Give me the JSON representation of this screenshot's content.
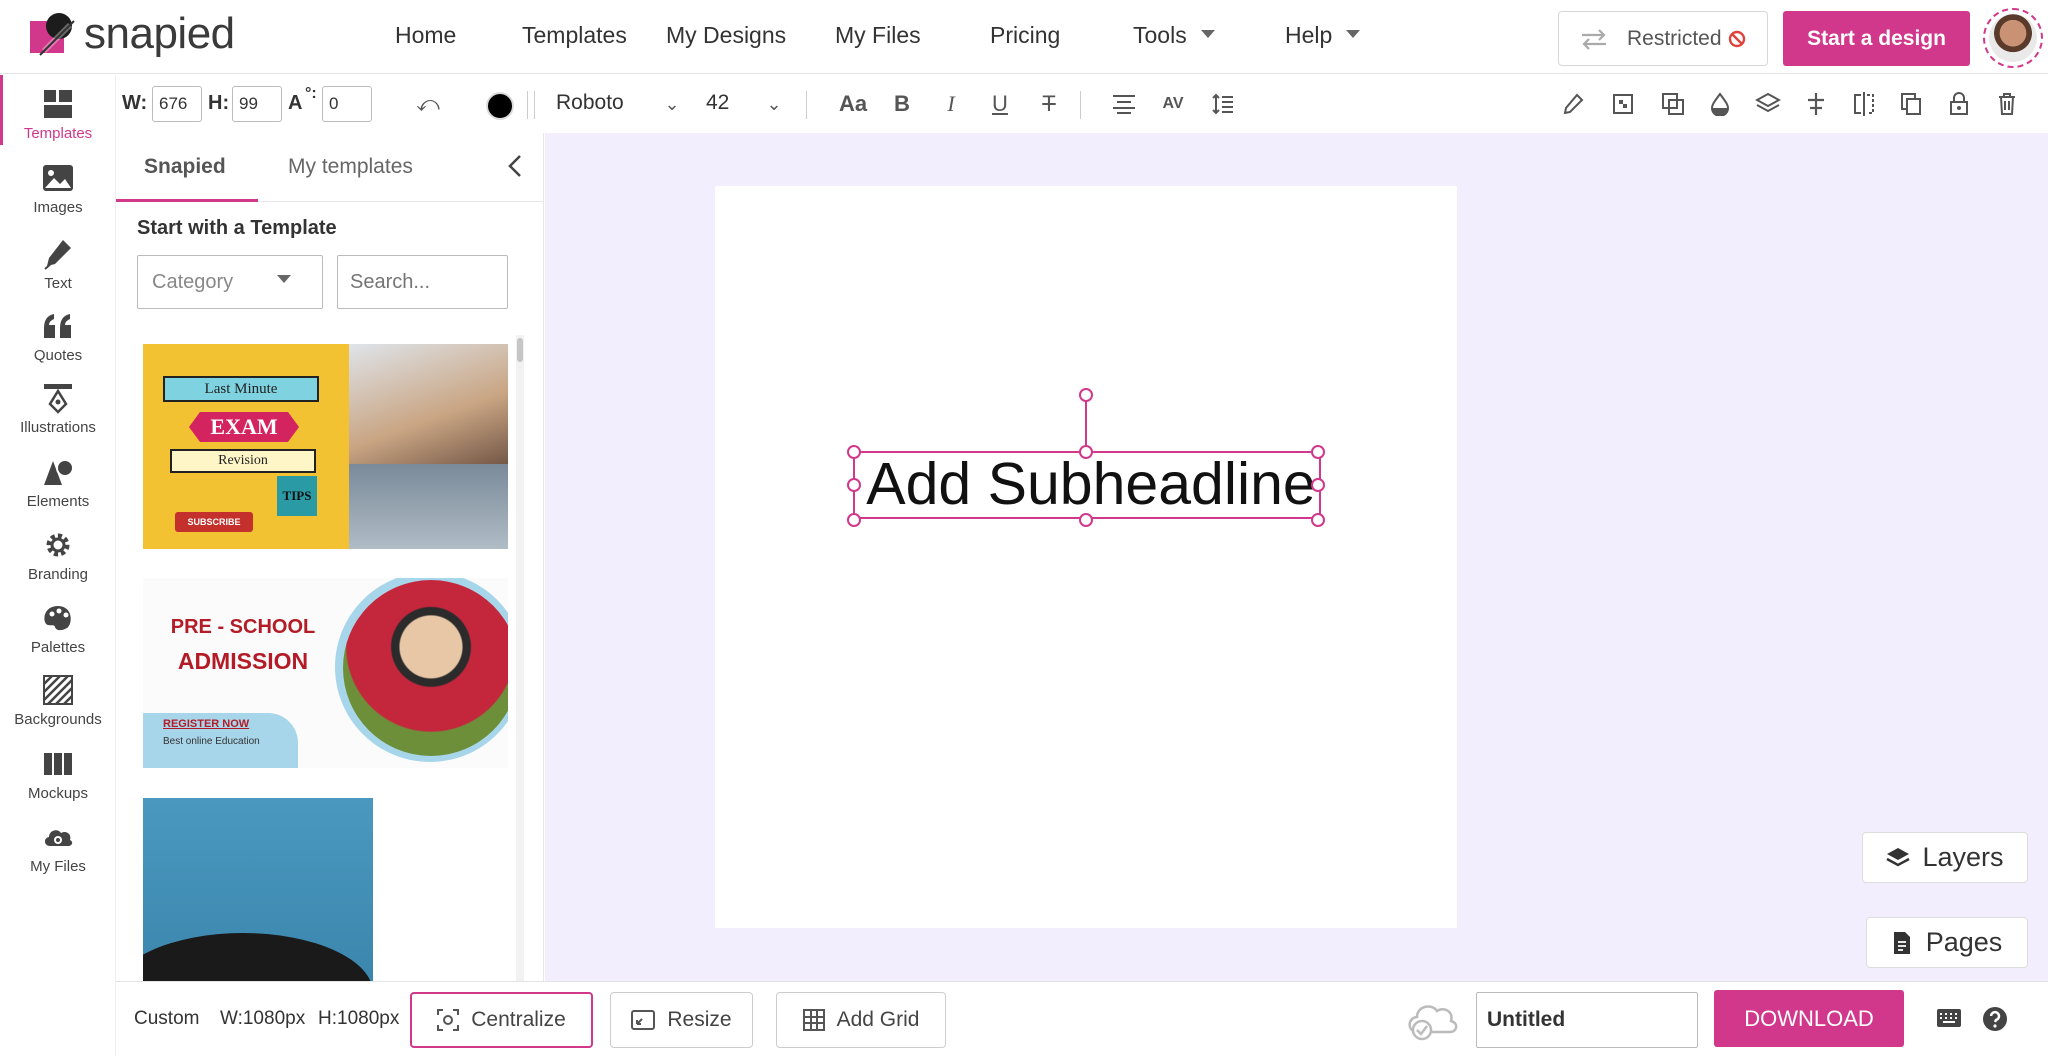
{
  "app": {
    "name": "snapied"
  },
  "nav": {
    "links": [
      "Home",
      "Templates",
      "My Designs",
      "My Files",
      "Pricing",
      "Tools",
      "Help"
    ],
    "restricted_label": "Restricted",
    "start_design_label": "Start a design"
  },
  "sidebar": {
    "items": [
      {
        "label": "Templates",
        "icon": "templates-icon"
      },
      {
        "label": "Images",
        "icon": "images-icon"
      },
      {
        "label": "Text",
        "icon": "pen-icon"
      },
      {
        "label": "Quotes",
        "icon": "quotes-icon"
      },
      {
        "label": "Illustrations",
        "icon": "illustrations-icon"
      },
      {
        "label": "Elements",
        "icon": "elements-icon"
      },
      {
        "label": "Branding",
        "icon": "gear-icon"
      },
      {
        "label": "Palettes",
        "icon": "palette-icon"
      },
      {
        "label": "Backgrounds",
        "icon": "backgrounds-icon"
      },
      {
        "label": "Mockups",
        "icon": "mockups-icon"
      },
      {
        "label": "My Files",
        "icon": "cloud-files-icon"
      }
    ],
    "active": "Templates"
  },
  "toolbar": {
    "w_label": "W:",
    "w_value": "676",
    "h_label": "H:",
    "h_value": "99",
    "angle_label": "A",
    "angle_sup": "°:",
    "angle_value": "0",
    "font": "Roboto",
    "font_size": "42",
    "text_color": "#000000"
  },
  "panel": {
    "tabs": [
      "Snapied",
      "My templates"
    ],
    "active_tab": "Snapied",
    "title": "Start with a Template",
    "category_label": "Category",
    "search_placeholder": "Search...",
    "templates": [
      {
        "lines": [
          "Last Minute",
          "EXAM",
          "Revision",
          "TIPS",
          "SUBSCRIBE"
        ]
      },
      {
        "lines": [
          "PRE - SCHOOL",
          "ADMISSION",
          "REGISTER NOW",
          "Best online Education"
        ]
      },
      {
        "lines": []
      }
    ]
  },
  "canvas": {
    "headline_text": "Add Subheadline",
    "accent_color": "#d1388b",
    "workspace_bg": "#f3eefd"
  },
  "float_buttons": {
    "layers": "Layers",
    "pages": "Pages"
  },
  "bottom": {
    "preset": "Custom",
    "width": "W:1080px",
    "height": "H:1080px",
    "centralize": "Centralize",
    "resize": "Resize",
    "add_grid": "Add Grid",
    "filename": "Untitled",
    "download": "DOWNLOAD"
  }
}
